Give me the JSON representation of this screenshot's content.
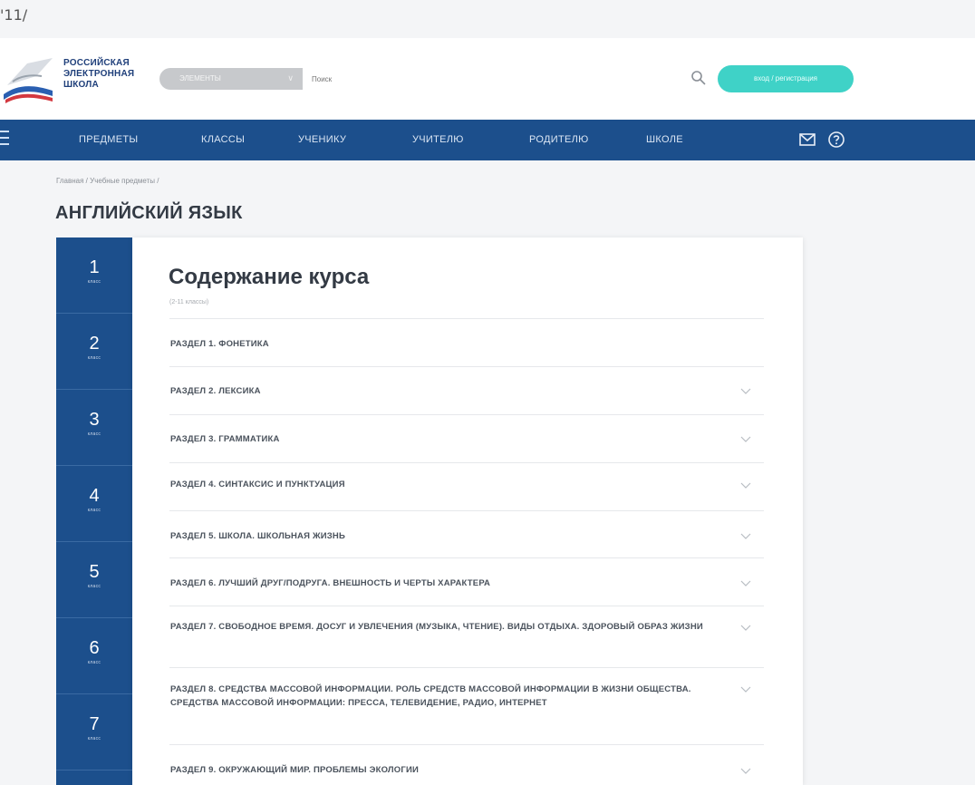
{
  "browser": {
    "url_fragment": "'11/"
  },
  "header": {
    "logo_lines": [
      "РОССИЙСКАЯ",
      "ЭЛЕКТРОННАЯ",
      "ШКОЛА"
    ],
    "search_select_value": "ЭЛЕМЕНТЫ",
    "search_placeholder": "Поиск",
    "login_label": "вход / регистрация"
  },
  "nav": {
    "items": [
      "ПРЕДМЕТЫ",
      "КЛАССЫ",
      "УЧЕНИКУ",
      "УЧИТЕЛЮ",
      "РОДИТЕЛЮ",
      "ШКОЛЕ"
    ],
    "icons": [
      "menu-icon",
      "mail-icon",
      "help-icon"
    ]
  },
  "breadcrumb": "Главная / Учебные предметы /",
  "page_title": "АНГЛИЙСКИЙ ЯЗЫК",
  "grades": {
    "label": "класс",
    "items": [
      "1",
      "2",
      "3",
      "4",
      "5",
      "6",
      "7"
    ]
  },
  "course": {
    "title": "Содержание курса",
    "subtitle": "(2-11 классы)",
    "sections": [
      "РАЗДЕЛ 1. ФОНЕТИКА",
      "РАЗДЕЛ 2. ЛЕКСИКА",
      "РАЗДЕЛ 3. ГРАММАТИКА",
      "РАЗДЕЛ 4. СИНТАКСИС И ПУНКТУАЦИЯ",
      "РАЗДЕЛ 5. ШКОЛА. ШКОЛЬНАЯ ЖИЗНЬ",
      "РАЗДЕЛ 6. ЛУЧШИЙ ДРУГ/ПОДРУГА. ВНЕШНОСТЬ И ЧЕРТЫ ХАРАКТЕРА",
      "РАЗДЕЛ 7. СВОБОДНОЕ ВРЕМЯ. ДОСУГ И УВЛЕЧЕНИЯ (МУЗЫКА, ЧТЕНИЕ). ВИДЫ ОТДЫХА. ЗДОРОВЫЙ ОБРАЗ ЖИЗНИ",
      "РАЗДЕЛ 8. СРЕДСТВА МАССОВОЙ ИНФОРМАЦИИ. РОЛЬ СРЕДСТВ МАССОВОЙ ИНФОРМАЦИИ В ЖИЗНИ ОБЩЕСТВА. СРЕДСТВА МАССОВОЙ ИНФОРМАЦИИ: ПРЕССА, ТЕЛЕВИДЕНИЕ, РАДИО, ИНТЕРНЕТ",
      "РАЗДЕЛ 9. ОКРУЖАЮЩИЙ МИР. ПРОБЛЕМЫ ЭКОЛОГИИ"
    ],
    "expandable_icon": "chevron-down-icon"
  },
  "colors": {
    "nav_blue": "#1c4f8c",
    "accent_teal": "#3fd2c7",
    "page_bg": "#f4f5f7"
  }
}
